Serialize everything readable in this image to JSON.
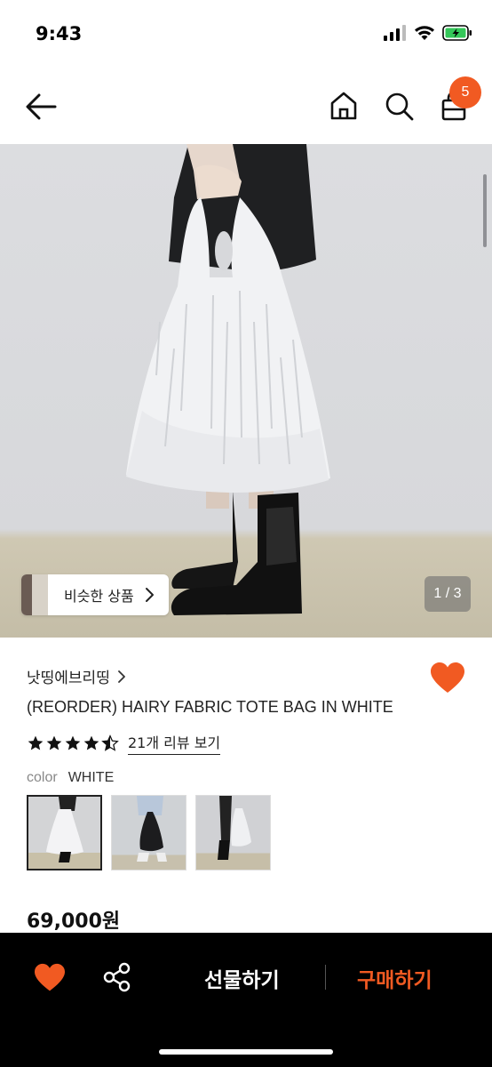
{
  "status_bar": {
    "time": "9:43"
  },
  "header": {
    "cart_count": "5"
  },
  "hero": {
    "similar_label": "비슷한 상품",
    "page_indicator": "1 / 3"
  },
  "product": {
    "brand": "낫띵에브리띵",
    "title": "(REORDER) HAIRY FABRIC TOTE BAG IN WHITE",
    "rating": 4.5,
    "review_link": "21개 리뷰 보기",
    "option_label": "color",
    "option_value": "WHITE",
    "price": "69,000원"
  },
  "bottom_bar": {
    "gift_label": "선물하기",
    "buy_label": "구매하기"
  },
  "colors": {
    "accent": "#f15a22",
    "bar": "#000000"
  }
}
